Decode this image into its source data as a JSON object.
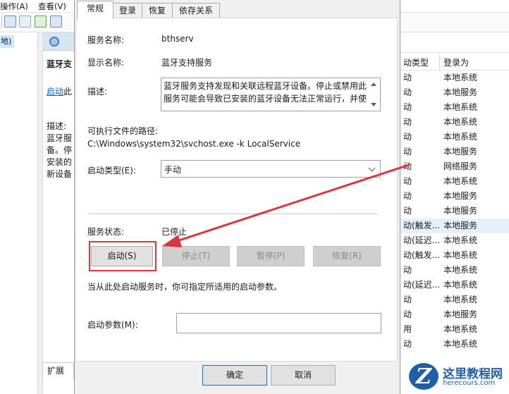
{
  "background": {
    "menu": [
      "操作(A)",
      "查看(V)"
    ],
    "left_tree_item": "地)",
    "middle": {
      "title": "蓝牙支",
      "start_link": "启动",
      "start_link_suffix": "此",
      "desc_label": "描述:",
      "desc_lines": [
        "蓝牙服",
        "备。停",
        "安装的",
        "新设备"
      ],
      "bottom_tab": "扩展"
    },
    "columns": {
      "startup_type": "动类型",
      "logon_as": "登录为"
    },
    "rows": [
      {
        "type": "动",
        "logon": "本地系统"
      },
      {
        "type": "动",
        "logon": "本地服务"
      },
      {
        "type": "动",
        "logon": "本地系统"
      },
      {
        "type": "动",
        "logon": "本地系统"
      },
      {
        "type": "动",
        "logon": "本地系统"
      },
      {
        "type": "动",
        "logon": "本地服务"
      },
      {
        "type": "动",
        "logon": "网络服务"
      },
      {
        "type": "动",
        "logon": "本地系统"
      },
      {
        "type": "动",
        "logon": "本地服务"
      },
      {
        "type": "动",
        "logon": "本地服务"
      },
      {
        "type": "动(触发...",
        "logon": "本地服务"
      },
      {
        "type": "动(延迟...",
        "logon": "本地系统"
      },
      {
        "type": "动(触发...",
        "logon": "本地系统"
      },
      {
        "type": "动",
        "logon": "本地系统"
      },
      {
        "type": "动(延迟...",
        "logon": "本地系统"
      },
      {
        "type": "动",
        "logon": "本地系统"
      },
      {
        "type": "动",
        "logon": "本地服务"
      },
      {
        "type": "用",
        "logon": "本地系统"
      },
      {
        "type": "动",
        "logon": "本地系统"
      }
    ]
  },
  "dialog": {
    "tabs": [
      "常规",
      "登录",
      "恢复",
      "依存关系"
    ],
    "service_name_label": "服务名称:",
    "service_name": "bthserv",
    "display_name_label": "显示名称:",
    "display_name": "蓝牙支持服务",
    "description_label": "描述:",
    "description": "蓝牙服务支持发现和关联远程蓝牙设备。停止或禁用此服务可能会导致已安装的蓝牙设备无法正常运行，并使",
    "exe_path_label": "可执行文件的路径:",
    "exe_path": "C:\\Windows\\system32\\svchost.exe -k LocalService",
    "startup_type_label": "启动类型(E):",
    "startup_type_value": "手动",
    "status_label": "服务状态:",
    "status_value": "已停止",
    "buttons": {
      "start": "启动(S)",
      "stop": "停止(T)",
      "pause": "暂停(P)",
      "resume": "恢复(R)"
    },
    "start_hint": "当从此处启动服务时，你可指定所适用的启动参数。",
    "start_params_label": "启动参数(M):",
    "start_params_value": "",
    "ok": "确定",
    "cancel": "取消"
  },
  "watermark": {
    "logo_letter": "Z",
    "title": "这里教程网",
    "url": "herecours.com",
    "color": "#1f5fa8"
  },
  "annotation": {
    "color": "#d9363e"
  }
}
